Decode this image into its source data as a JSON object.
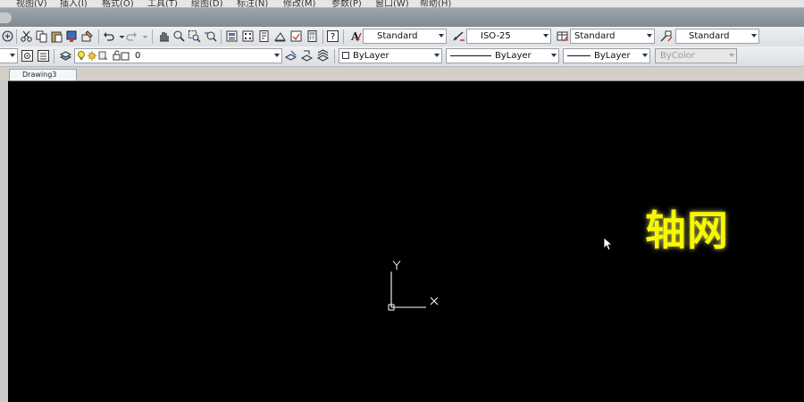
{
  "menu": [
    "视图(V)",
    "插入(I)",
    "格式(O)",
    "工具(T)",
    "绘图(D)",
    "标注(N)",
    "修改(M)",
    "参数(P)",
    "窗口(W)",
    "帮助(H)"
  ],
  "styles": {
    "text_style": "Standard",
    "dim_style": "ISO-25",
    "table_style": "Standard",
    "multileader_style": "Standard"
  },
  "layer": {
    "current": "0"
  },
  "properties": {
    "color": "ByLayer",
    "linetype": "ByLayer",
    "lineweight": "ByLayer",
    "plotstyle": "ByColor"
  },
  "tabs": {
    "drawing": "Drawing3"
  },
  "canvas": {
    "background": "#000000",
    "overlay_text": "轴网",
    "overlay_color": "#f7f700",
    "ucs_x": "X",
    "ucs_y": "Y"
  }
}
